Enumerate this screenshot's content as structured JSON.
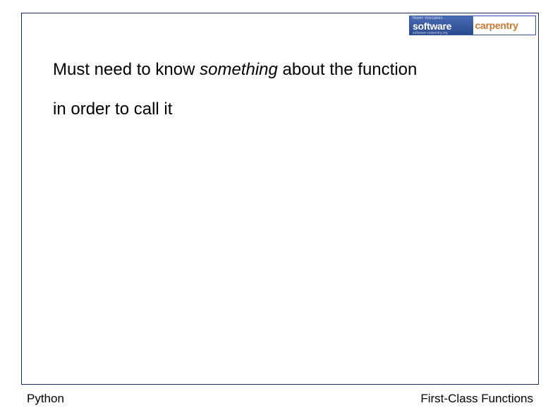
{
  "logo": {
    "tagline": "fewer mistakes",
    "software": "software",
    "carpentry": "carpentry",
    "url": "software-carpentry.org"
  },
  "content": {
    "line1_prefix": "Must need to know ",
    "line1_italic": "something",
    "line1_suffix": " about the function",
    "line2": "in order to call it"
  },
  "footer": {
    "left": "Python",
    "right": "First-Class Functions"
  }
}
